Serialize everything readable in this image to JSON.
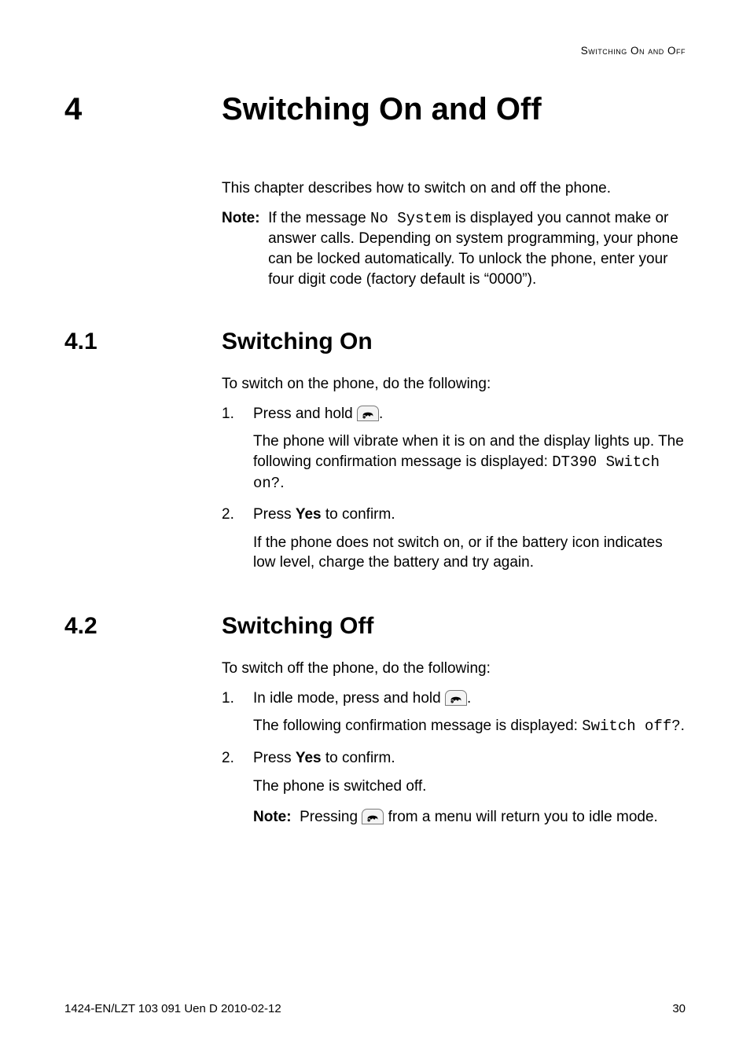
{
  "running_header": "Switching On and Off",
  "chapter": {
    "num": "4",
    "title": "Switching On and Off"
  },
  "intro": {
    "p1": "This chapter describes how to switch on and off the phone.",
    "note_label": "Note:  ",
    "note_a": "If the message ",
    "note_code": "No System",
    "note_b": " is displayed you cannot make or answer calls. Depending on system programming, your phone can be locked automatically. To unlock the phone, enter your four digit code (factory default is “0000”)."
  },
  "sec1": {
    "num": "4.1",
    "title": "Switching On",
    "lead": "To switch on the phone, do the following:",
    "step1_num": "1.",
    "step1_a": "Press and hold ",
    "step1_b": ".",
    "step1_sub_a": "The phone will vibrate when it is on and the display lights up. The following confirmation message is displayed: ",
    "step1_sub_code": "DT390 Switch on?",
    "step1_sub_b": ".",
    "step2_num": "2.",
    "step2_a": "Press ",
    "step2_bold": "Yes",
    "step2_b": " to confirm.",
    "step2_sub": "If the phone does not switch on, or if the battery icon indicates low level, charge the battery and try again."
  },
  "sec2": {
    "num": "4.2",
    "title": "Switching Off",
    "lead": "To switch off the phone, do the following:",
    "step1_num": "1.",
    "step1_a": "In idle mode, press and hold ",
    "step1_b": ".",
    "step1_sub_a": "The following confirmation message is displayed: ",
    "step1_sub_code": "Switch off?",
    "step1_sub_b": ".",
    "step2_num": "2.",
    "step2_a": "Press ",
    "step2_bold": "Yes",
    "step2_b": " to confirm.",
    "step2_sub": "The phone is switched off.",
    "note_label": "Note:  ",
    "note_a": "Pressing ",
    "note_b": " from a menu will return you to idle mode."
  },
  "footer": {
    "left": "1424-EN/LZT 103 091 Uen D 2010-02-12",
    "right": "30"
  },
  "icons": {
    "hook": "hook-icon"
  }
}
